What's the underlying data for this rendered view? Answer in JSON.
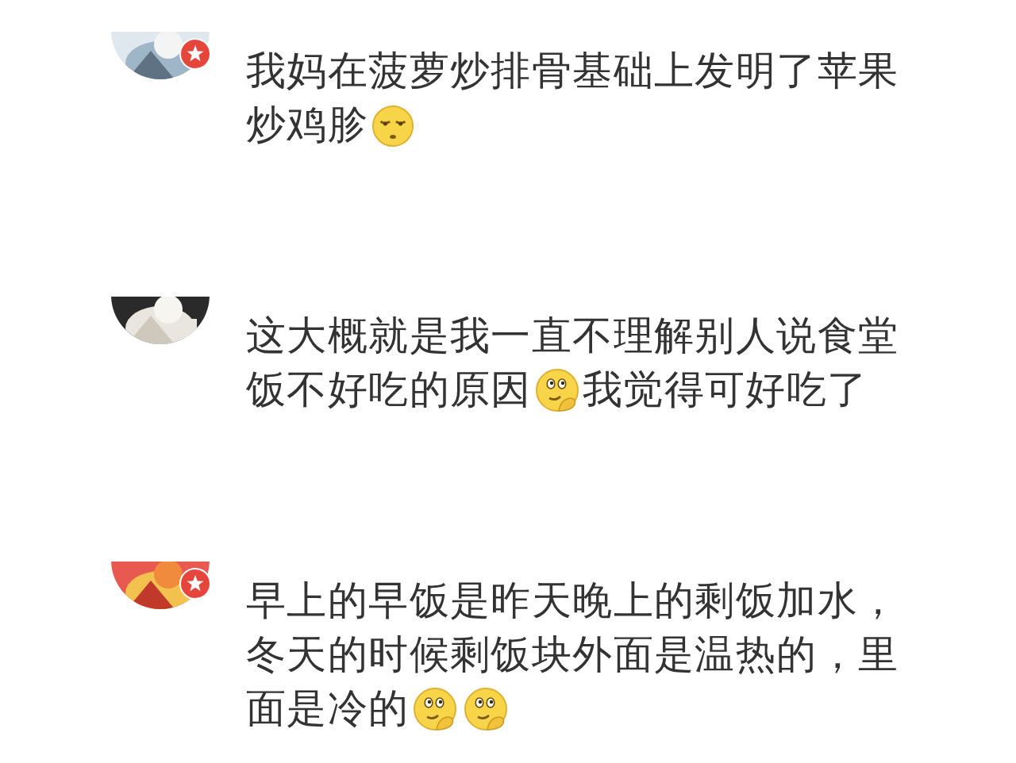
{
  "comments": [
    {
      "avatar": {
        "kind": "picture"
      },
      "verified": true,
      "lines": [
        [
          {
            "kind": "text",
            "text": "我妈在菠萝炒排骨基础上发明了苹果"
          }
        ],
        [
          {
            "kind": "text",
            "text": "炒鸡胗"
          },
          {
            "kind": "doze"
          }
        ]
      ]
    },
    {
      "avatar": {
        "kind": "picture"
      },
      "verified": false,
      "lines": [
        [
          {
            "kind": "text",
            "text": "这大概就是我一直不理解别人说食堂"
          }
        ],
        [
          {
            "kind": "text",
            "text": "饭不好吃的原因"
          },
          {
            "kind": "ponder"
          },
          {
            "kind": "text",
            "text": "我觉得可好吃了"
          }
        ]
      ]
    },
    {
      "avatar": {
        "kind": "picture"
      },
      "verified": true,
      "lines": [
        [
          {
            "kind": "text",
            "text": "早上的早饭是昨天晚上的剩饭加水，"
          }
        ],
        [
          {
            "kind": "text",
            "text": "冬天的时候剩饭块外面是温热的，里"
          }
        ],
        [
          {
            "kind": "text",
            "text": "面是冷的"
          },
          {
            "kind": "ponder"
          },
          {
            "kind": "ponder"
          }
        ]
      ]
    }
  ]
}
